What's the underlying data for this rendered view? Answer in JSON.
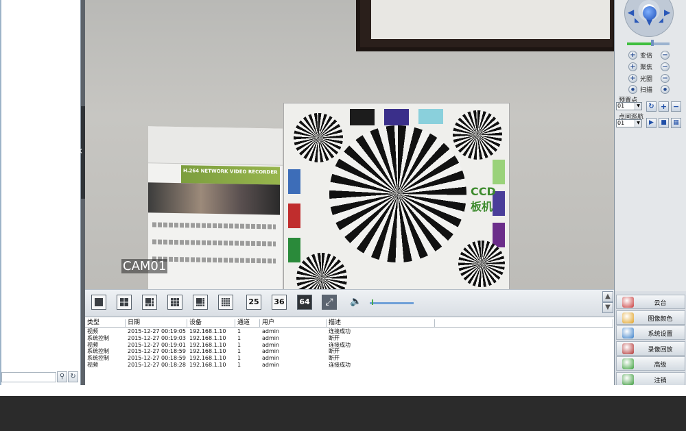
{
  "camera": {
    "label": "CAM01"
  },
  "scene": {
    "box_title": "H.264 NETWORK VIDEO RECORDER",
    "chart_text_1": "CCD",
    "chart_text_2": "板机"
  },
  "ptz": {
    "controls": [
      {
        "label": "变倍",
        "plus": "+",
        "minus": "−"
      },
      {
        "label": "聚焦",
        "plus": "+",
        "minus": "−"
      },
      {
        "label": "光圈",
        "plus": "+",
        "minus": "−"
      },
      {
        "label": "扫描",
        "plus": "●",
        "minus": "●"
      }
    ],
    "preset_label": "预置点",
    "preset_value": "01",
    "cruise_label": "点间巡航",
    "cruise_value": "01",
    "speed_level": 0.6
  },
  "toolbar": {
    "layouts": [
      "1",
      "4",
      "6",
      "9",
      "8",
      "16",
      "25",
      "36",
      "64"
    ],
    "volume_level": 0.05
  },
  "log": {
    "columns": [
      "类型",
      "日期",
      "设备",
      "通道",
      "用户",
      "描述"
    ],
    "rows": [
      {
        "type": "视频",
        "date": "2015-12-27 00:19:05",
        "device": "192.168.1.10",
        "channel": "1",
        "user": "admin",
        "desc": "连接成功"
      },
      {
        "type": "系统控制",
        "date": "2015-12-27 00:19:03",
        "device": "192.168.1.10",
        "channel": "1",
        "user": "admin",
        "desc": "断开"
      },
      {
        "type": "视频",
        "date": "2015-12-27 00:19:01",
        "device": "192.168.1.10",
        "channel": "1",
        "user": "admin",
        "desc": "连接成功"
      },
      {
        "type": "系统控制",
        "date": "2015-12-27 00:18:59",
        "device": "192.168.1.10",
        "channel": "1",
        "user": "admin",
        "desc": "断开"
      },
      {
        "type": "系统控制",
        "date": "2015-12-27 00:18:59",
        "device": "192.168.1.10",
        "channel": "1",
        "user": "admin",
        "desc": "断开"
      },
      {
        "type": "视频",
        "date": "2015-12-27 00:18:28",
        "device": "192.168.1.10",
        "channel": "1",
        "user": "admin",
        "desc": "连接成功"
      }
    ]
  },
  "functions": [
    {
      "label": "云台",
      "icon": "ptz-icon",
      "color": "#c83a3a"
    },
    {
      "label": "图像颜色",
      "icon": "color-icon",
      "color": "#e0a020"
    },
    {
      "label": "系统设置",
      "icon": "settings-icon",
      "color": "#3a7fc8"
    },
    {
      "label": "录像回放",
      "icon": "playback-icon",
      "color": "#b03030"
    },
    {
      "label": "高级",
      "icon": "advanced-icon",
      "color": "#3aa03a"
    },
    {
      "label": "注销",
      "icon": "logout-icon",
      "color": "#3a9a3a"
    }
  ]
}
